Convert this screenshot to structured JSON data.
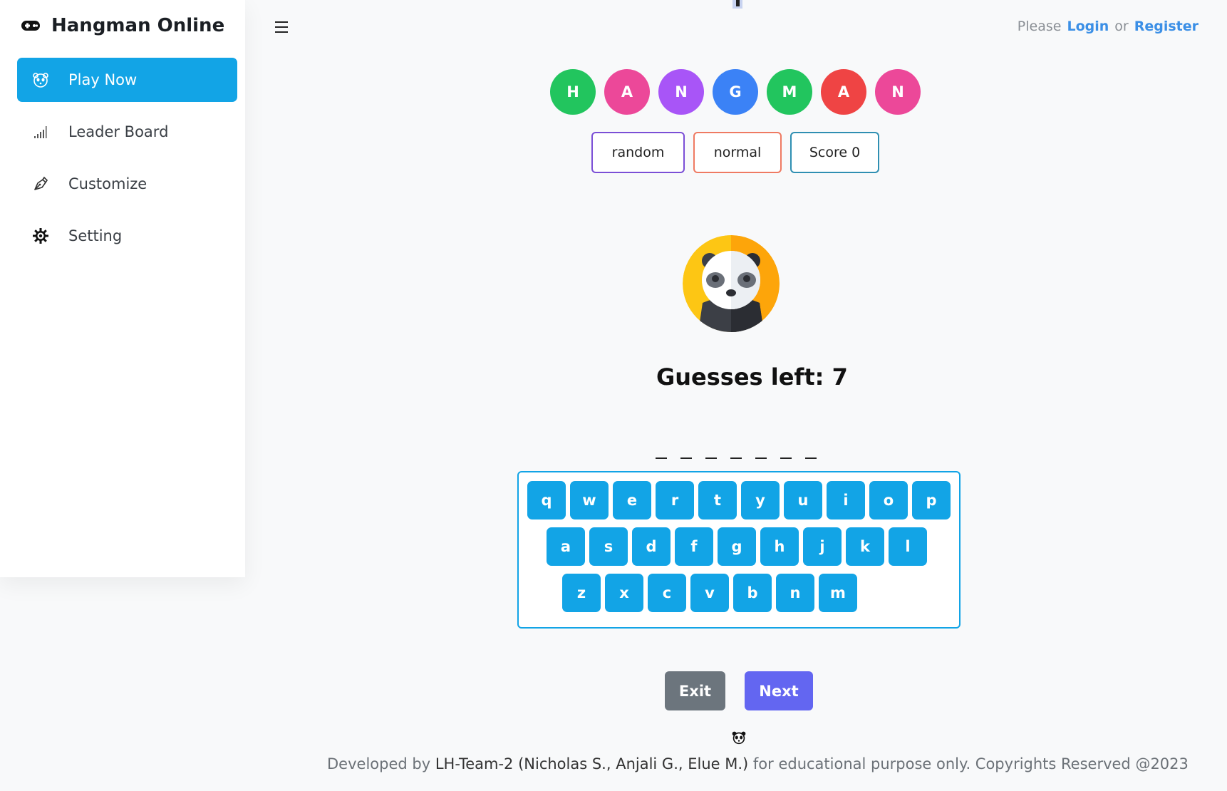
{
  "app": {
    "brand_title": "Hangman Online",
    "brand_icon": "gamepad-icon"
  },
  "sidebar": {
    "items": [
      {
        "label": "Play Now",
        "icon": "panda-icon",
        "active": true
      },
      {
        "label": "Leader Board",
        "icon": "signal-bars-icon",
        "active": false
      },
      {
        "label": "Customize",
        "icon": "pen-nib-icon",
        "active": false
      },
      {
        "label": "Setting",
        "icon": "gear-icon",
        "active": false
      }
    ],
    "active_color": "#12a4e6"
  },
  "topbar": {
    "auth_prefix": "Please",
    "login_label": "Login",
    "auth_middle": "or",
    "register_label": "Register"
  },
  "title_letters": [
    {
      "letter": "H",
      "color": "#22c55e"
    },
    {
      "letter": "A",
      "color": "#ec4899"
    },
    {
      "letter": "N",
      "color": "#a855f7"
    },
    {
      "letter": "G",
      "color": "#3b82f6"
    },
    {
      "letter": "M",
      "color": "#22c55e"
    },
    {
      "letter": "A",
      "color": "#ef4444"
    },
    {
      "letter": "N",
      "color": "#ec4899"
    }
  ],
  "badges": {
    "category": "random",
    "difficulty": "normal",
    "score": "Score 0"
  },
  "game": {
    "guesses_text": "Guesses left: 7",
    "word_length": 7
  },
  "keyboard": {
    "rows": [
      [
        "q",
        "w",
        "e",
        "r",
        "t",
        "y",
        "u",
        "i",
        "o",
        "p"
      ],
      [
        "a",
        "s",
        "d",
        "f",
        "g",
        "h",
        "j",
        "k",
        "l"
      ],
      [
        "z",
        "x",
        "c",
        "v",
        "b",
        "n",
        "m"
      ]
    ]
  },
  "actions": {
    "exit_label": "Exit",
    "next_label": "Next"
  },
  "footer": {
    "prefix": "Developed by",
    "team": "LH-Team-2 (Nicholas S., Anjali G., Elue M.)",
    "suffix": "for educational purpose only. Copyrights Reserved @2023"
  }
}
